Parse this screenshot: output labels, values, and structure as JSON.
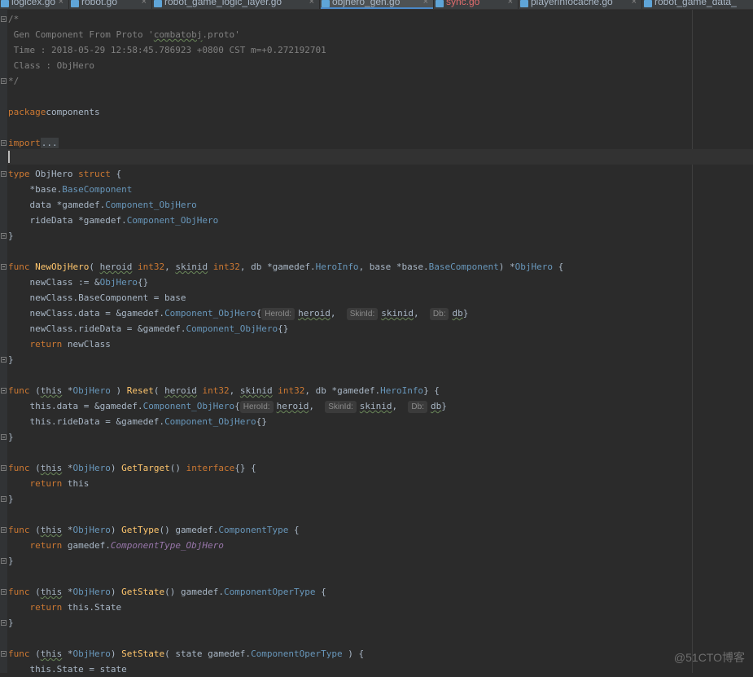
{
  "tabs": [
    {
      "label": "logicex.go",
      "active": false,
      "warn": false
    },
    {
      "label": "robot.go",
      "active": false,
      "warn": false
    },
    {
      "label": "robot_game_logic_layer.go",
      "active": false,
      "warn": false
    },
    {
      "label": "objhero_gen.go",
      "active": true,
      "warn": false
    },
    {
      "label": "sync.go",
      "active": false,
      "warn": true
    },
    {
      "label": "playerinfocache.go",
      "active": false,
      "warn": false
    },
    {
      "label": "robot_game_data_",
      "active": false,
      "warn": false
    }
  ],
  "tab_close_glyph": "×",
  "colors": {
    "background": "#2b2b2b",
    "keyword": "#cc7832",
    "type": "#6897bb",
    "function": "#ffc66d",
    "comment": "#808080",
    "text": "#a9b7c6",
    "constant": "#9876aa"
  },
  "code_lines": [
    [
      [
        "cm",
        "/*"
      ]
    ],
    [
      [
        "cm",
        " Gen Component From Proto '"
      ],
      [
        "cm ul",
        "combatobj"
      ],
      [
        "cm",
        ".proto'"
      ]
    ],
    [
      [
        "cm",
        " Time : 2018-05-29 12:58:45.786923 +0800 CST m=+0.272192701"
      ]
    ],
    [
      [
        "cm",
        " Class : ObjHero"
      ]
    ],
    [
      [
        "cm",
        "*/"
      ]
    ],
    [],
    [
      [
        "kw",
        "package"
      ],
      [
        "",
        "components"
      ]
    ],
    [],
    [
      [
        "kw",
        "import"
      ],
      [
        "fd",
        "..."
      ]
    ],
    [],
    [
      [
        "kw",
        "type "
      ],
      [
        "",
        "ObjHero "
      ],
      [
        "kw",
        "struct "
      ],
      [
        "",
        "{"
      ]
    ],
    [
      [
        "",
        "    *base."
      ],
      [
        "tp",
        "BaseComponent"
      ]
    ],
    [
      [
        "",
        "    data *gamedef."
      ],
      [
        "tp",
        "Component_ObjHero"
      ]
    ],
    [
      [
        "",
        "    rideData *gamedef."
      ],
      [
        "tp",
        "Component_ObjHero"
      ]
    ],
    [
      [
        "",
        "}"
      ]
    ],
    [],
    [
      [
        "kw",
        "func "
      ],
      [
        "fn",
        "NewObjHero"
      ],
      [
        "",
        "( "
      ],
      [
        "ul",
        "heroid"
      ],
      [
        "",
        " "
      ],
      [
        "kw",
        "int32"
      ],
      [
        "",
        ", "
      ],
      [
        "ul",
        "skinid"
      ],
      [
        "",
        " "
      ],
      [
        "kw",
        "int32"
      ],
      [
        "",
        ", db *gamedef."
      ],
      [
        "tp",
        "HeroInfo"
      ],
      [
        "",
        ", base *base."
      ],
      [
        "tp",
        "BaseComponent"
      ],
      [
        "",
        ") *"
      ],
      [
        "tp",
        "ObjHero"
      ],
      [
        "",
        " {"
      ]
    ],
    [
      [
        "",
        "    newClass := &"
      ],
      [
        "tp",
        "ObjHero"
      ],
      [
        "",
        "{}"
      ]
    ],
    [
      [
        "",
        "    newClass.BaseComponent = base"
      ]
    ],
    [
      [
        "",
        "    newClass.data = &gamedef."
      ],
      [
        "tp",
        "Component_ObjHero"
      ],
      [
        "",
        "{"
      ],
      [
        "hint",
        "HeroId:"
      ],
      [
        "ul",
        "heroid"
      ],
      [
        "",
        ",  "
      ],
      [
        "hint",
        "SkinId:"
      ],
      [
        "ul",
        "skinid"
      ],
      [
        "",
        ",  "
      ],
      [
        "hint",
        "Db:"
      ],
      [
        "ul",
        "db"
      ],
      [
        "",
        "}"
      ]
    ],
    [
      [
        "",
        "    newClass.rideData = &gamedef."
      ],
      [
        "tp",
        "Component_ObjHero"
      ],
      [
        "",
        "{}"
      ]
    ],
    [
      [
        "kw",
        "    return "
      ],
      [
        "",
        "newClass"
      ]
    ],
    [
      [
        "",
        "}"
      ]
    ],
    [],
    [
      [
        "kw",
        "func "
      ],
      [
        "",
        "("
      ],
      [
        "ul",
        "this"
      ],
      [
        "",
        " *"
      ],
      [
        "tp",
        "ObjHero"
      ],
      [
        "",
        " ) "
      ],
      [
        "fn",
        "Reset"
      ],
      [
        "",
        "( "
      ],
      [
        "ul",
        "heroid"
      ],
      [
        "",
        " "
      ],
      [
        "kw",
        "int32"
      ],
      [
        "",
        ", "
      ],
      [
        "ul",
        "skinid"
      ],
      [
        "",
        " "
      ],
      [
        "kw",
        "int32"
      ],
      [
        "",
        ", db *gamedef."
      ],
      [
        "tp",
        "HeroInfo"
      ],
      [
        "",
        "} {"
      ]
    ],
    [
      [
        "",
        "    this.data = &gamedef."
      ],
      [
        "tp",
        "Component_ObjHero"
      ],
      [
        "",
        "{"
      ],
      [
        "hint",
        "HeroId:"
      ],
      [
        "ul",
        "heroid"
      ],
      [
        "",
        ",  "
      ],
      [
        "hint",
        "SkinId:"
      ],
      [
        "ul",
        "skinid"
      ],
      [
        "",
        ",  "
      ],
      [
        "hint",
        "Db:"
      ],
      [
        "ul",
        "db"
      ],
      [
        "",
        "}"
      ]
    ],
    [
      [
        "",
        "    this.rideData = &gamedef."
      ],
      [
        "tp",
        "Component_ObjHero"
      ],
      [
        "",
        "{}"
      ]
    ],
    [
      [
        "",
        "}"
      ]
    ],
    [],
    [
      [
        "kw",
        "func "
      ],
      [
        "",
        "("
      ],
      [
        "ul",
        "this"
      ],
      [
        "",
        " *"
      ],
      [
        "tp",
        "ObjHero"
      ],
      [
        "",
        ") "
      ],
      [
        "fn",
        "GetTarget"
      ],
      [
        "",
        "() "
      ],
      [
        "kw",
        "interface"
      ],
      [
        "",
        "{} {"
      ]
    ],
    [
      [
        "kw",
        "    return "
      ],
      [
        "",
        "this"
      ]
    ],
    [
      [
        "",
        "}"
      ]
    ],
    [],
    [
      [
        "kw",
        "func "
      ],
      [
        "",
        "("
      ],
      [
        "ul",
        "this"
      ],
      [
        "",
        " *"
      ],
      [
        "tp",
        "ObjHero"
      ],
      [
        "",
        ") "
      ],
      [
        "fn",
        "GetType"
      ],
      [
        "",
        "() gamedef."
      ],
      [
        "tp",
        "ComponentType"
      ],
      [
        "",
        " {"
      ]
    ],
    [
      [
        "kw",
        "    return "
      ],
      [
        "",
        "gamedef."
      ],
      [
        "it",
        "ComponentType_ObjHero"
      ]
    ],
    [
      [
        "",
        "}"
      ]
    ],
    [],
    [
      [
        "kw",
        "func "
      ],
      [
        "",
        "("
      ],
      [
        "ul",
        "this"
      ],
      [
        "",
        " *"
      ],
      [
        "tp",
        "ObjHero"
      ],
      [
        "",
        ") "
      ],
      [
        "fn",
        "GetState"
      ],
      [
        "",
        "() gamedef."
      ],
      [
        "tp",
        "ComponentOperType"
      ],
      [
        "",
        " {"
      ]
    ],
    [
      [
        "kw",
        "    return "
      ],
      [
        "",
        "this.State"
      ]
    ],
    [
      [
        "",
        "}"
      ]
    ],
    [],
    [
      [
        "kw",
        "func "
      ],
      [
        "",
        "("
      ],
      [
        "ul",
        "this"
      ],
      [
        "",
        " *"
      ],
      [
        "tp",
        "ObjHero"
      ],
      [
        "",
        ") "
      ],
      [
        "fn",
        "SetState"
      ],
      [
        "",
        "( state gamedef."
      ],
      [
        "tp",
        "ComponentOperType"
      ],
      [
        "",
        " ) {"
      ]
    ],
    [
      [
        "",
        "    this.State = state"
      ]
    ]
  ],
  "watermark": "@51CTO博客"
}
